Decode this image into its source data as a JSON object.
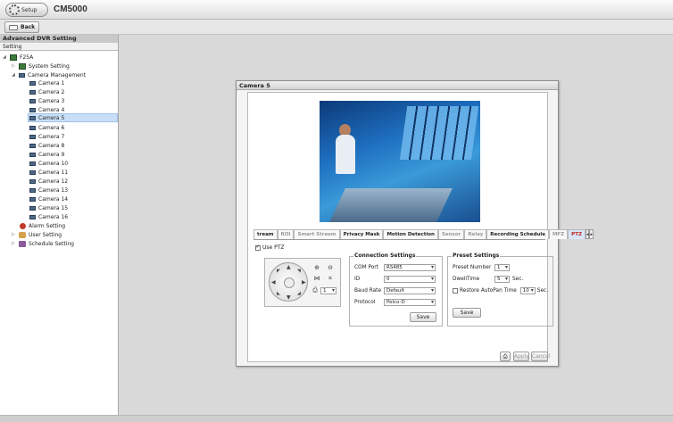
{
  "app": {
    "setup_label": "Setup",
    "title": "CM5000"
  },
  "toolbar": {
    "back_label": "Back"
  },
  "sidebar": {
    "header": "Advanced DVR Setting",
    "subheader": "Setting",
    "root": "F25A",
    "system": "System Setting",
    "camera_mgmt": "Camera Management",
    "cameras": [
      "Camera 1",
      "Camera 2",
      "Camera 3",
      "Camera 4",
      "Camera 5",
      "Camera 6",
      "Camera 7",
      "Camera 8",
      "Camera 9",
      "Camera 10",
      "Camera 11",
      "Camera 12",
      "Camera 13",
      "Camera 14",
      "Camera 15",
      "Camera 16"
    ],
    "selected": "Camera 5",
    "alarm": "Alarm Setting",
    "user": "User Setting",
    "schedule": "Schedule Setting"
  },
  "dialog": {
    "title": "Camera 5",
    "tabs": [
      {
        "label": "tream",
        "state": "normal"
      },
      {
        "label": "ROI",
        "state": "disabled"
      },
      {
        "label": "Smart Stream",
        "state": "disabled"
      },
      {
        "label": "Privacy Mask",
        "state": "normal"
      },
      {
        "label": "Motion Detection",
        "state": "normal"
      },
      {
        "label": "Sensor",
        "state": "disabled"
      },
      {
        "label": "Relay",
        "state": "disabled"
      },
      {
        "label": "Recording Schedule",
        "state": "normal"
      },
      {
        "label": "MFZ",
        "state": "disabled"
      },
      {
        "label": "PTZ",
        "state": "active"
      }
    ],
    "use_ptz": {
      "label": "Use PTZ",
      "checked": true
    },
    "ptz_pad": {
      "preset_value": "1"
    },
    "connection": {
      "title": "Connection Settings",
      "com_port_label": "COM Port",
      "com_port_value": "RS485",
      "id_label": "ID",
      "id_value": "0",
      "baud_label": "Baud Rate",
      "baud_value": "Default",
      "protocol_label": "Protocol",
      "protocol_value": "Pelco-D",
      "save": "Save"
    },
    "preset": {
      "title": "Preset Settings",
      "number_label": "Preset Number",
      "number_value": "1",
      "dwell_label": "DwellTime",
      "dwell_value": "5",
      "dwell_unit": "Sec.",
      "restore_label": "Restore AutoPan Time",
      "restore_value": "10",
      "restore_unit": "Sec.",
      "restore_checked": false,
      "save": "Save"
    },
    "footer": {
      "apply": "Apply",
      "cancel": "Cancel"
    }
  }
}
